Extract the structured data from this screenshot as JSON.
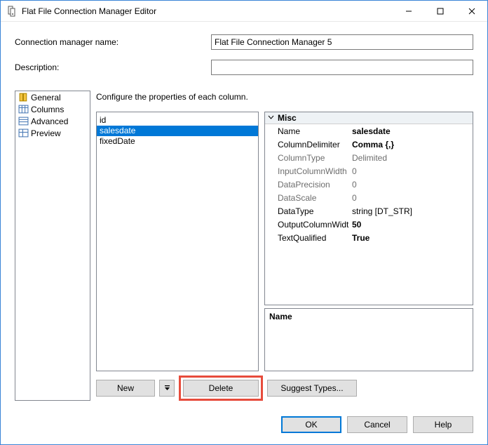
{
  "window": {
    "title": "Flat File Connection Manager Editor"
  },
  "form": {
    "name_label": "Connection manager name:",
    "name_value": "Flat File Connection Manager 5",
    "desc_label": "Description:",
    "desc_value": ""
  },
  "nav": {
    "items": [
      {
        "label": "General"
      },
      {
        "label": "Columns"
      },
      {
        "label": "Advanced"
      },
      {
        "label": "Preview"
      }
    ]
  },
  "main": {
    "hint": "Configure the properties of each column.",
    "columns": [
      {
        "name": "id",
        "selected": false
      },
      {
        "name": "salesdate",
        "selected": true
      },
      {
        "name": "fixedDate",
        "selected": false
      }
    ]
  },
  "props": {
    "group": "Misc",
    "rows": [
      {
        "key": "Name",
        "value": "salesdate",
        "bold": true,
        "disabled": false
      },
      {
        "key": "ColumnDelimiter",
        "value": "Comma {,}",
        "bold": true,
        "disabled": false
      },
      {
        "key": "ColumnType",
        "value": "Delimited",
        "bold": false,
        "disabled": true
      },
      {
        "key": "InputColumnWidth",
        "value": "0",
        "bold": false,
        "disabled": true
      },
      {
        "key": "DataPrecision",
        "value": "0",
        "bold": false,
        "disabled": true
      },
      {
        "key": "DataScale",
        "value": "0",
        "bold": false,
        "disabled": true
      },
      {
        "key": "DataType",
        "value": "string [DT_STR]",
        "bold": false,
        "disabled": false
      },
      {
        "key": "OutputColumnWidth",
        "value": "50",
        "bold": true,
        "disabled": false
      },
      {
        "key": "TextQualified",
        "value": "True",
        "bold": true,
        "disabled": false
      }
    ],
    "desc_title": "Name",
    "desc_text": ""
  },
  "buttons": {
    "new": "New",
    "delete": "Delete",
    "suggest": "Suggest Types...",
    "ok": "OK",
    "cancel": "Cancel",
    "help": "Help"
  }
}
